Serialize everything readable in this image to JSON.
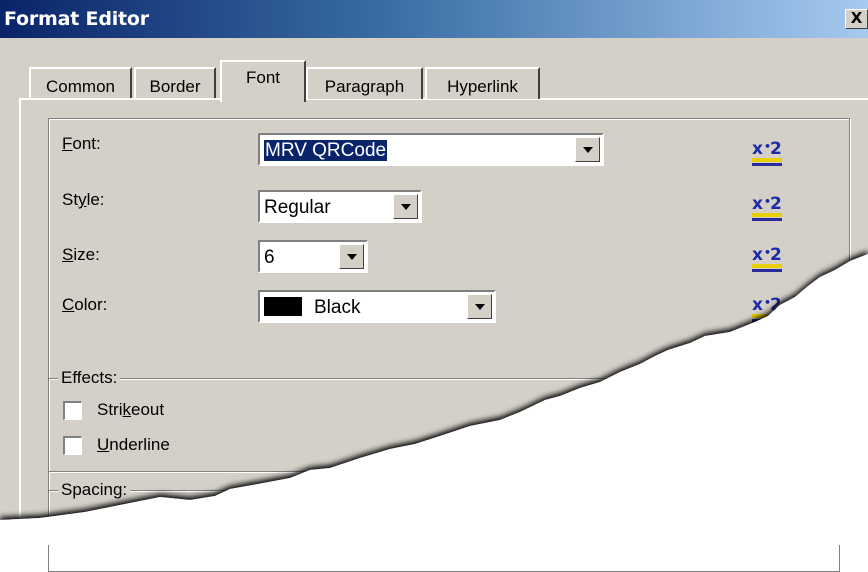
{
  "window": {
    "title": "Format Editor",
    "close_glyph": "X"
  },
  "tabs": [
    {
      "label": "Common",
      "active": false
    },
    {
      "label": "Border",
      "active": false
    },
    {
      "label": "Font",
      "active": true
    },
    {
      "label": "Paragraph",
      "active": false
    },
    {
      "label": "Hyperlink",
      "active": false
    }
  ],
  "font_section": {
    "font": {
      "label_mnemonic": "F",
      "label_rest": "ont:",
      "value": "MRV QRCode"
    },
    "style": {
      "label_before": "St",
      "label_mnemonic": "y",
      "label_after": "le:",
      "value": "Regular"
    },
    "size": {
      "label_mnemonic": "S",
      "label_rest": "ize:",
      "value": "6"
    },
    "color": {
      "label_mnemonic": "C",
      "label_rest": "olor:",
      "value": "Black",
      "swatch": "#000000"
    },
    "formula_icon": "formula-x2-icon"
  },
  "effects": {
    "legend": "Effects:",
    "strikeout": {
      "before": "Stri",
      "mnemonic": "k",
      "after": "eout",
      "checked": false
    },
    "underline": {
      "mnemonic": "U",
      "after": "nderline",
      "checked": false
    }
  },
  "spacing": {
    "legend": "Spacing:"
  },
  "colors": {
    "dialog": "#d4d0c8",
    "title_start": "#0a246a",
    "title_end": "#a6caf0",
    "selection": "#0a246a"
  }
}
